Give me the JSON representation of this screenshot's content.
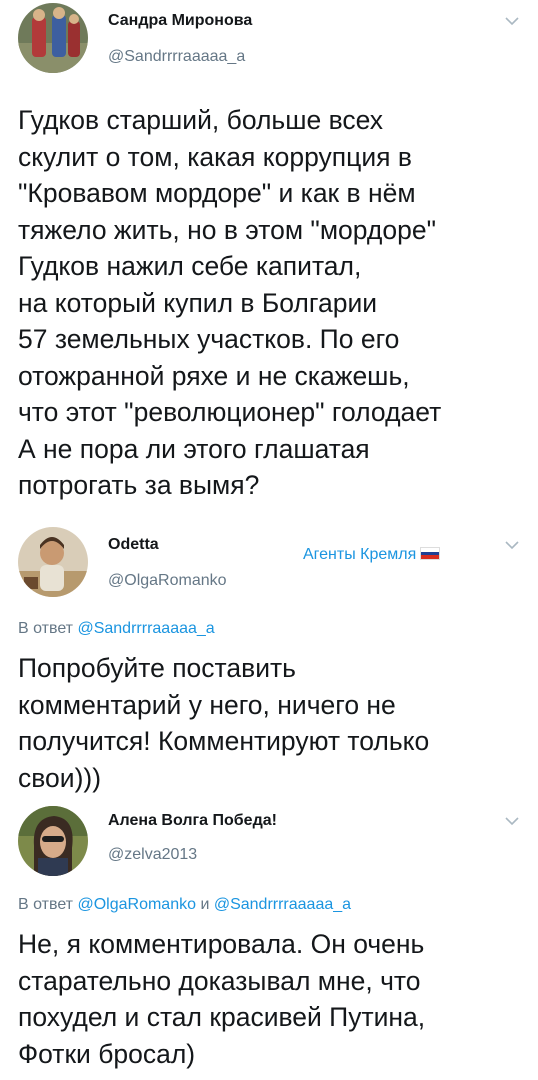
{
  "tweets": [
    {
      "author": "Сандра Миронова",
      "handle": "@Sandrrrraaaaa_a",
      "lines": [
        "Гудков старший, больше всех",
        "скулит о том, какая коррупция в",
        "\"Кровавом мордоре\" и как в нём",
        "тяжело жить, но в этом \"мордоре\"",
        "Гудков  нажил себе капитал,",
        "на который купил в Болгарии",
        "57 земельных участков. По его",
        "отожранной ряхе и не скажешь,",
        "что этот  \"революционер\" голодает",
        "А не пора ли этого глашатая",
        "потрогать за вымя?"
      ]
    },
    {
      "author": "Odetta",
      "handle": "@OlgaRomanko",
      "badge": "Агенты Кремля",
      "reply_prefix": "В ответ",
      "reply_to": "@Sandrrrraaaaa_a",
      "lines": [
        "Попробуйте поставить",
        "комментарий у него,  ничего не",
        "получится! Комментируют только",
        "свои)))"
      ]
    },
    {
      "author": "Алена Волга Победа!",
      "handle": "@zelva2013",
      "reply_prefix": "В ответ",
      "reply_to_1": "@OlgaRomanko",
      "reply_and": "и",
      "reply_to_2": "@Sandrrrraaaaa_a",
      "lines": [
        "Не, я комментировала. Он очень",
        "старательно доказывал мне, что",
        "похудел и стал красивей Путина,",
        "Фотки бросал)"
      ]
    }
  ],
  "colors": {
    "text": "#14171a",
    "secondary": "#657786",
    "link": "#1b95e0"
  },
  "icons": {
    "menu": "chevron-down-icon",
    "flag": "russian-flag-icon"
  }
}
